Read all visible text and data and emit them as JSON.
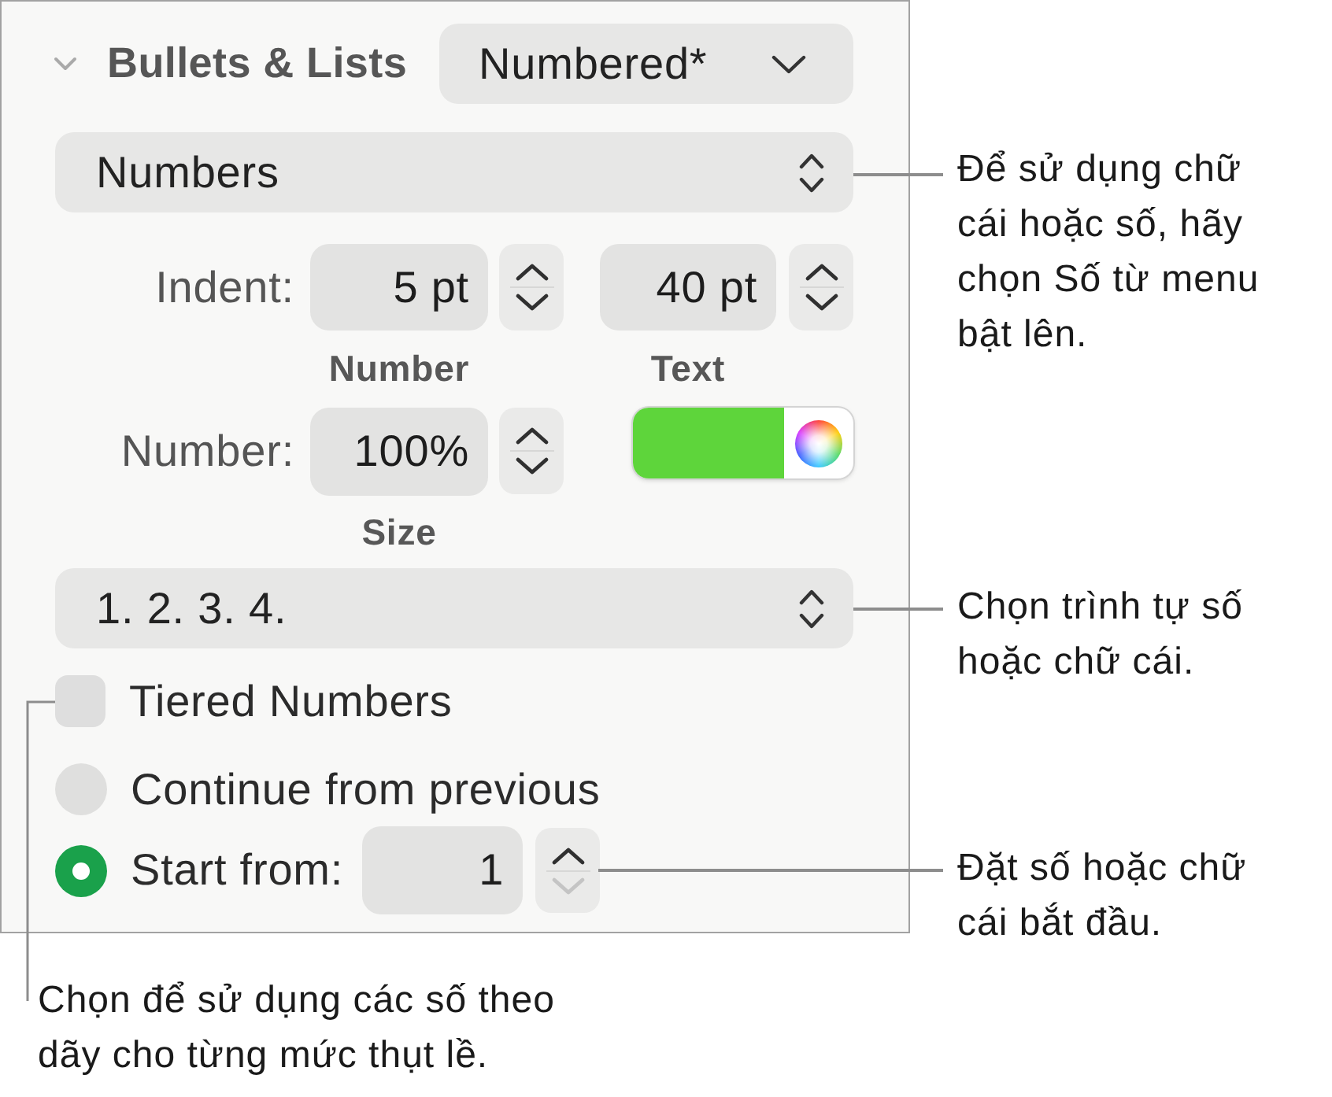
{
  "panel": {
    "section": {
      "title": "Bullets & Lists",
      "expanded": true,
      "style_menu": "Numbered*"
    },
    "list_type_menu": "Numbers",
    "indent_row": {
      "label": "Indent:",
      "fields": [
        {
          "value": "5 pt",
          "caption": "Number",
          "down_disabled": false
        },
        {
          "value": "40 pt",
          "caption": "Text",
          "down_disabled": false
        }
      ]
    },
    "size_row": {
      "label": "Number:",
      "value": "100%",
      "caption": "Size",
      "down_disabled": false,
      "color": "#5ed53b"
    },
    "sequence_menu": "1. 2. 3. 4.",
    "tiered_numbers": {
      "label": "Tiered Numbers",
      "checked": false
    },
    "numbering": [
      {
        "label": "Continue from previous",
        "selected": false
      },
      {
        "label": "Start from:",
        "selected": true,
        "value": "1",
        "down_disabled": true
      }
    ]
  },
  "callouts": [
    {
      "text": "Để sử dụng chữ cái hoặc số, hãy chọn Số từ menu bật lên."
    },
    {
      "text": "Chọn trình tự số hoặc chữ cái."
    },
    {
      "text": "Đặt số hoặc chữ cái bắt đầu."
    },
    {
      "text": "Chọn để sử dụng các số theo dãy cho từng mức thụt lề."
    }
  ]
}
